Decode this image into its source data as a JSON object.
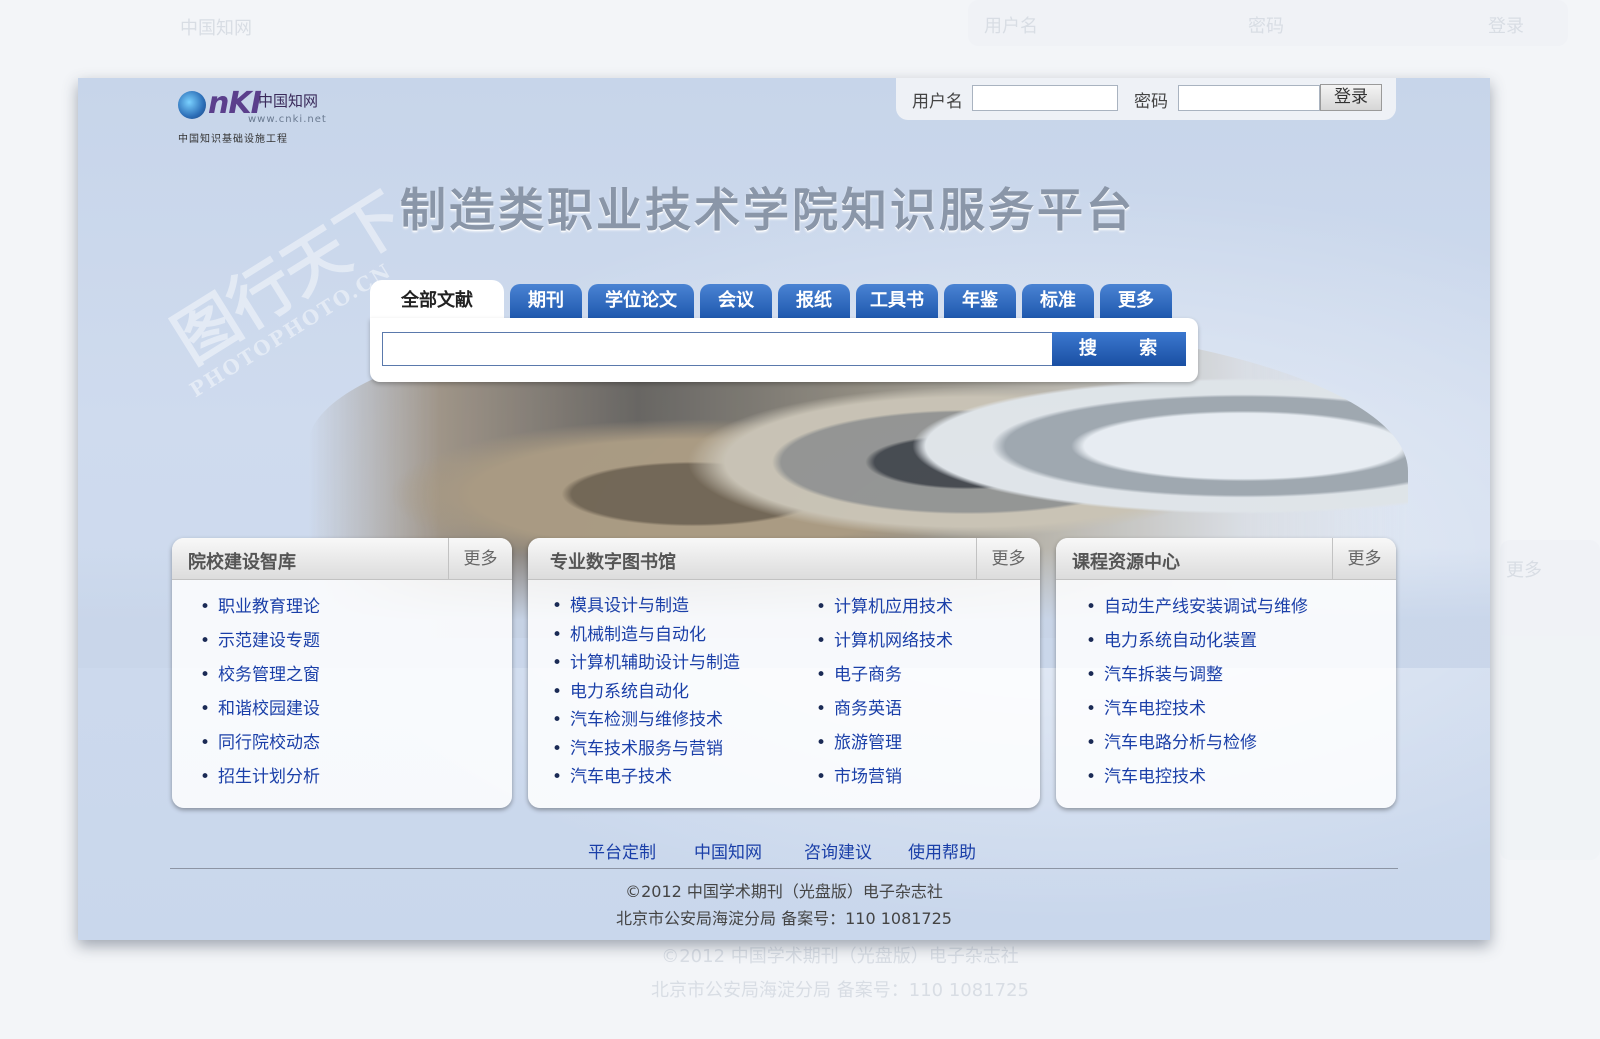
{
  "background_ghost": {
    "login_user_label": "用户名",
    "login_pass_label": "密码",
    "login_button": "登录",
    "more": "更多",
    "copyright": "©2012 中国学术期刊（光盘版）电子杂志社",
    "icp": "北京市公安局海淀分局 备案号：110 1081725"
  },
  "logo": {
    "mark": "nKI",
    "chinese": "中国知网",
    "url": "www.cnki.net",
    "subtitle": "中国知识基础设施工程"
  },
  "login": {
    "username_label": "用户名",
    "password_label": "密码",
    "button": "登录",
    "username_value": "",
    "password_value": ""
  },
  "title": "制造类职业技术学院知识服务平台",
  "search": {
    "tabs": [
      "全部文献",
      "期刊",
      "学位论文",
      "会议",
      "报纸",
      "工具书",
      "年鉴",
      "标准",
      "更多"
    ],
    "active_tab": "全部文献",
    "query": "",
    "button": "搜 索"
  },
  "panels": [
    {
      "title": "院校建设智库",
      "more": "更多",
      "items": [
        "职业教育理论",
        "示范建设专题",
        "校务管理之窗",
        "和谐校园建设",
        "同行院校动态",
        "招生计划分析"
      ]
    },
    {
      "title": "专业数字图书馆",
      "more": "更多",
      "items_left": [
        "模具设计与制造",
        "机械制造与自动化",
        "计算机辅助设计与制造",
        "电力系统自动化",
        "汽车检测与维修技术",
        "汽车技术服务与营销",
        "汽车电子技术"
      ],
      "items_right": [
        "计算机应用技术",
        "计算机网络技术",
        "电子商务",
        "商务英语",
        "旅游管理",
        "市场营销"
      ]
    },
    {
      "title": "课程资源中心",
      "more": "更多",
      "items": [
        "自动生产线安装调试与维修",
        "电力系统自动化装置",
        "汽车拆装与调整",
        "汽车电控技术",
        "汽车电路分析与检修",
        "汽车电控技术"
      ]
    }
  ],
  "footer": {
    "links": [
      "平台定制",
      "中国知网",
      "咨询建议",
      "使用帮助"
    ],
    "copyright": "©2012 中国学术期刊（光盘版）电子杂志社",
    "icp": "北京市公安局海淀分局 备案号：110 1081725"
  },
  "watermark": {
    "cn": "图行天下",
    "en": "PHOTOPHOTO.CN"
  },
  "colors": {
    "card_bg": "#c9d6ea",
    "tab_blue": "#1c56ac",
    "link_blue": "#1a3fa8",
    "title_gray": "#8a96a8"
  }
}
